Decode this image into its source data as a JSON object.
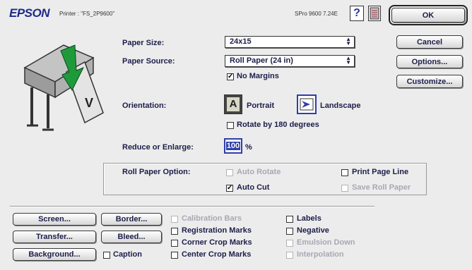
{
  "header": {
    "brand": "EPSON",
    "printer_label": "Printer : \"FS_2P9600\"",
    "version": "SPro 9600 7.24E",
    "help_label": "?"
  },
  "buttons": {
    "ok": "OK",
    "cancel": "Cancel",
    "options": "Options...",
    "customize": "Customize...",
    "screen": "Screen...",
    "transfer": "Transfer...",
    "background": "Background...",
    "border": "Border...",
    "bleed": "Bleed..."
  },
  "paper": {
    "size_label": "Paper Size:",
    "size_value": "24x15",
    "source_label": "Paper Source:",
    "source_value": "Roll Paper (24 in)",
    "no_margins": "No Margins"
  },
  "orientation": {
    "label": "Orientation:",
    "portrait": "Portrait",
    "landscape": "Landscape",
    "rotate": "Rotate by 180 degrees",
    "selected": "Landscape"
  },
  "reduce": {
    "label": "Reduce or Enlarge:",
    "value": "100",
    "unit": "%"
  },
  "roll_paper": {
    "label": "Roll Paper Option:",
    "auto_rotate": "Auto Rotate",
    "auto_cut": "Auto Cut",
    "print_page_line": "Print Page Line",
    "save_roll_paper": "Save Roll Paper"
  },
  "print_options": {
    "caption": "Caption",
    "calibration_bars": "Calibration Bars",
    "registration_marks": "Registration Marks",
    "corner_crop_marks": "Corner Crop Marks",
    "center_crop_marks": "Center Crop Marks",
    "labels": "Labels",
    "negative": "Negative",
    "emulsion_down": "Emulsion Down",
    "interpolation": "Interpolation"
  },
  "preview": {
    "page_letter": "V"
  },
  "check_mark": "✓",
  "icons": {
    "help": "help-icon",
    "printer_manual": "printer-manual-icon",
    "portrait": "portrait-icon",
    "landscape": "landscape-icon"
  },
  "colors": {
    "brand": "#1c2a8a",
    "preview_arrow": "#1e9a3a",
    "selection": "#2f3ea8"
  }
}
